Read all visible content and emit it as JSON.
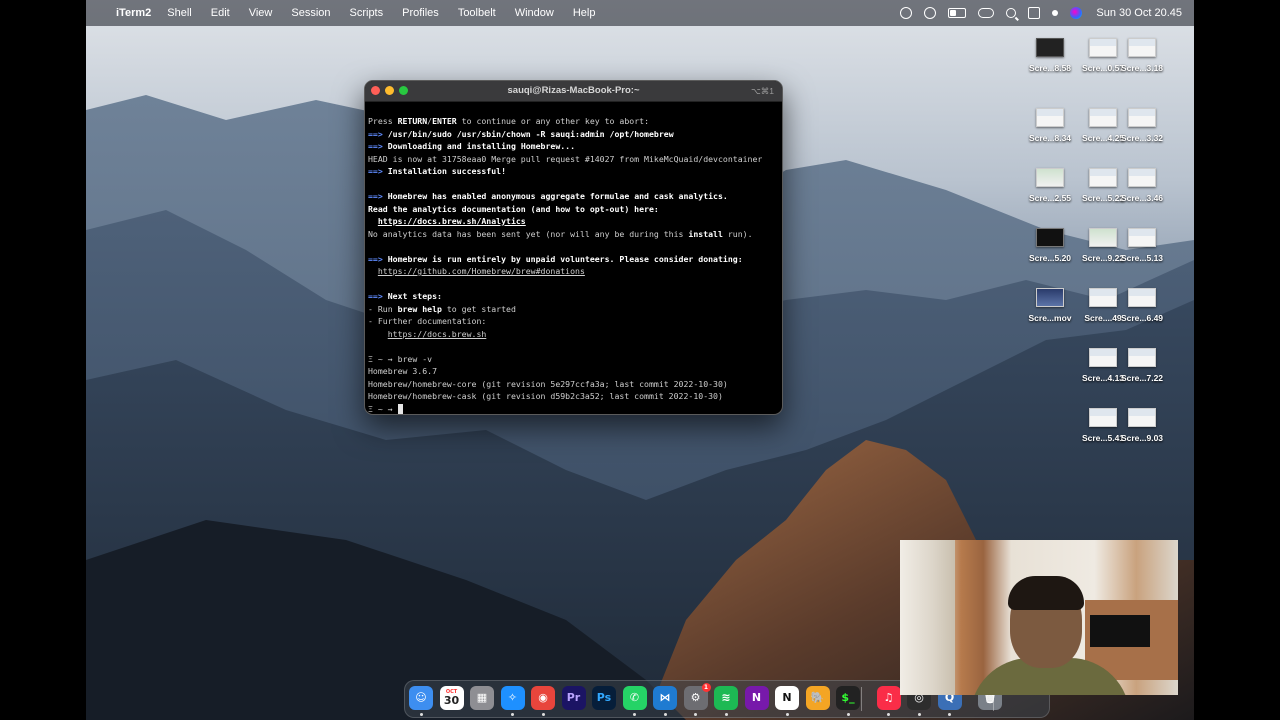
{
  "menubar": {
    "apple_icon": "apple-icon",
    "app_name": "iTerm2",
    "menus": [
      "Shell",
      "Edit",
      "View",
      "Session",
      "Scripts",
      "Profiles",
      "Toolbelt",
      "Window",
      "Help"
    ],
    "status_icons": [
      "creative-cloud-icon",
      "play-icon",
      "battery-icon",
      "screen-mirror-icon",
      "search-icon",
      "control-center-icon",
      "user-icon",
      "siri-icon"
    ],
    "clock": "Sun 30 Oct  20.45"
  },
  "terminal": {
    "title": "sauqi@Rizas-MacBook-Pro:~",
    "shortcut": "⌥⌘1",
    "lines": [
      {
        "parts": [
          {
            "t": "Press ",
            "s": ""
          },
          {
            "t": "RETURN",
            "s": "b"
          },
          {
            "t": "/",
            "s": ""
          },
          {
            "t": "ENTER",
            "s": "b"
          },
          {
            "t": " to continue or any other key to abort:",
            "s": ""
          }
        ]
      },
      {
        "parts": [
          {
            "t": "==>",
            "s": "arrow"
          },
          {
            "t": " /usr/bin/sudo /usr/sbin/chown -R sauqi:admin /opt/homebrew",
            "s": "b"
          }
        ]
      },
      {
        "parts": [
          {
            "t": "==>",
            "s": "arrow"
          },
          {
            "t": " Downloading and installing Homebrew...",
            "s": "b"
          }
        ]
      },
      {
        "parts": [
          {
            "t": "HEAD is now at 31758eaa0 Merge pull request #14027 from MikeMcQuaid/devcontainer",
            "s": ""
          }
        ]
      },
      {
        "parts": [
          {
            "t": "==>",
            "s": "arrow"
          },
          {
            "t": " Installation successful!",
            "s": "b"
          }
        ]
      },
      {
        "parts": [
          {
            "t": "",
            "s": ""
          }
        ]
      },
      {
        "parts": [
          {
            "t": "==>",
            "s": "arrow"
          },
          {
            "t": " Homebrew has enabled anonymous aggregate formulae and cask analytics.",
            "s": "b"
          }
        ]
      },
      {
        "parts": [
          {
            "t": "Read the analytics documentation (and how to opt-out) here:",
            "s": "b"
          }
        ]
      },
      {
        "parts": [
          {
            "t": "  ",
            "s": ""
          },
          {
            "t": "https://docs.brew.sh/Analytics",
            "s": "b ul"
          }
        ]
      },
      {
        "parts": [
          {
            "t": "No analytics data has been sent yet (nor will any be during this ",
            "s": ""
          },
          {
            "t": "install",
            "s": "b"
          },
          {
            "t": " run).",
            "s": ""
          }
        ]
      },
      {
        "parts": [
          {
            "t": "",
            "s": ""
          }
        ]
      },
      {
        "parts": [
          {
            "t": "==>",
            "s": "arrow"
          },
          {
            "t": " Homebrew is run entirely by unpaid volunteers. Please consider donating:",
            "s": "b"
          }
        ]
      },
      {
        "parts": [
          {
            "t": "  ",
            "s": ""
          },
          {
            "t": "https://github.com/Homebrew/brew#donations",
            "s": "ul"
          }
        ]
      },
      {
        "parts": [
          {
            "t": "",
            "s": ""
          }
        ]
      },
      {
        "parts": [
          {
            "t": "==>",
            "s": "arrow"
          },
          {
            "t": " Next steps:",
            "s": "b"
          }
        ]
      },
      {
        "parts": [
          {
            "t": "- Run ",
            "s": ""
          },
          {
            "t": "brew help",
            "s": "b"
          },
          {
            "t": " to get started",
            "s": ""
          }
        ]
      },
      {
        "parts": [
          {
            "t": "- Further documentation:",
            "s": ""
          }
        ]
      },
      {
        "parts": [
          {
            "t": "    ",
            "s": ""
          },
          {
            "t": "https://docs.brew.sh",
            "s": "ul"
          }
        ]
      },
      {
        "parts": [
          {
            "t": "",
            "s": ""
          }
        ]
      },
      {
        "parts": [
          {
            "t": "Ξ ~ → brew -v",
            "s": ""
          }
        ]
      },
      {
        "parts": [
          {
            "t": "Homebrew 3.6.7",
            "s": ""
          }
        ]
      },
      {
        "parts": [
          {
            "t": "Homebrew/homebrew-core (git revision 5e297ccfa3a; last commit 2022-10-30)",
            "s": ""
          }
        ]
      },
      {
        "parts": [
          {
            "t": "Homebrew/homebrew-cask (git revision d59b2c3a52; last commit 2022-10-30)",
            "s": ""
          }
        ]
      }
    ],
    "prompt": "Ξ ~ → "
  },
  "desktop_icons": [
    {
      "label": "Scre...8.58",
      "kind": "dark"
    },
    {
      "label": "Scre...0.57",
      "kind": "web"
    },
    {
      "label": "Scre...3.18",
      "kind": "web"
    },
    {
      "label": "Scre...8.34",
      "kind": "web"
    },
    {
      "label": "Scre...4.25",
      "kind": "web"
    },
    {
      "label": "Scre...3.32",
      "kind": "web"
    },
    {
      "label": "Scre...2.55",
      "kind": "green"
    },
    {
      "label": "Scre...5.22",
      "kind": "web"
    },
    {
      "label": "Scre...3.46",
      "kind": "web"
    },
    {
      "label": "Scre...5.20",
      "kind": "term"
    },
    {
      "label": "Scre...9.22",
      "kind": "green"
    },
    {
      "label": "Scre...5.13",
      "kind": "web"
    },
    {
      "label": "Scre...mov",
      "kind": "vid"
    },
    {
      "label": "Scre....49",
      "kind": "web"
    },
    {
      "label": "Scre...6.49",
      "kind": "web"
    },
    {
      "label": "Scre...4.13",
      "kind": "web"
    },
    {
      "label": "Scre...7.22",
      "kind": "web"
    },
    {
      "label": "Scre...5.41",
      "kind": "web"
    },
    {
      "label": "Scre...9.03",
      "kind": "web"
    }
  ],
  "dock": {
    "apps": [
      {
        "name": "finder-icon",
        "glyph": "☺",
        "color": "#3d8ef0"
      },
      {
        "name": "calendar-icon",
        "glyph": "30",
        "color": "#ffffff",
        "text": "#222",
        "sub": "OCT"
      },
      {
        "name": "launchpad-icon",
        "glyph": "▦",
        "color": "#8e8e93"
      },
      {
        "name": "safari-icon",
        "glyph": "✧",
        "color": "#1e90ff"
      },
      {
        "name": "chrome-icon",
        "glyph": "◉",
        "color": "#e8453c"
      },
      {
        "name": "premiere-icon",
        "glyph": "Pr",
        "color": "#1b1464",
        "text": "#b9a3ff"
      },
      {
        "name": "photoshop-icon",
        "glyph": "Ps",
        "color": "#061e3a",
        "text": "#31a8ff"
      },
      {
        "name": "whatsapp-icon",
        "glyph": "✆",
        "color": "#25d366"
      },
      {
        "name": "vscode-icon",
        "glyph": "⋈",
        "color": "#1f7bd1"
      },
      {
        "name": "system-preferences-icon",
        "glyph": "⚙",
        "color": "#6d6d72",
        "badge": "1"
      },
      {
        "name": "spotify-icon",
        "glyph": "≋",
        "color": "#1db954"
      },
      {
        "name": "onenote-icon",
        "glyph": "N",
        "color": "#7719aa"
      },
      {
        "name": "notion-icon",
        "glyph": "N",
        "color": "#ffffff",
        "text": "#111"
      },
      {
        "name": "tableplus-icon",
        "glyph": "🐘",
        "color": "#f4a524"
      },
      {
        "name": "iterm-icon",
        "glyph": "$_",
        "color": "#222222",
        "text": "#3f3"
      },
      {
        "name": "music-icon",
        "glyph": "♫",
        "color": "#fa2d48"
      },
      {
        "name": "obs-icon",
        "glyph": "◎",
        "color": "#2d2d2d"
      },
      {
        "name": "quicktime-icon",
        "glyph": "Q",
        "color": "#3b6fb6"
      },
      {
        "name": "trash-icon",
        "glyph": "🗑",
        "color": "#7a8088"
      }
    ]
  },
  "webcam": {
    "label": "webcam-overlay"
  }
}
